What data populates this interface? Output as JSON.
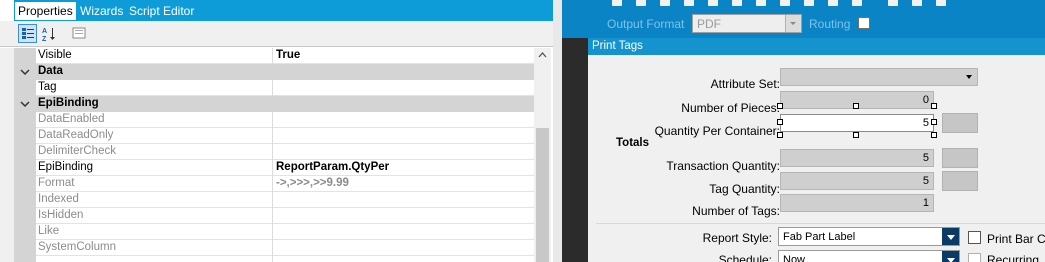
{
  "properties_panel": {
    "tabs": [
      {
        "label": "Properties"
      },
      {
        "label": "Wizards"
      },
      {
        "label": "Script Editor"
      }
    ],
    "toolbar_icons": [
      "categorized-icon",
      "alphabetical-sort-icon",
      "property-pages-icon"
    ],
    "rows": [
      {
        "name": "Visible",
        "value": "True",
        "type": "prop",
        "value_style": "bold"
      },
      {
        "name": "Data",
        "value": "",
        "type": "category"
      },
      {
        "name": "Tag",
        "value": "",
        "type": "prop"
      },
      {
        "name": "EpiBinding",
        "value": "",
        "type": "category"
      },
      {
        "name": "DataEnabled",
        "value": "",
        "type": "prop",
        "name_style": "dim"
      },
      {
        "name": "DataReadOnly",
        "value": "",
        "type": "prop",
        "name_style": "dim"
      },
      {
        "name": "DelimiterCheck",
        "value": "",
        "type": "prop",
        "name_style": "dim"
      },
      {
        "name": "EpiBinding",
        "value": "ReportParam.QtyPer",
        "type": "prop",
        "value_style": "bold"
      },
      {
        "name": "Format",
        "value": "->,>>>,>>9.99",
        "type": "prop",
        "name_style": "dim",
        "value_style": "bold-dim"
      },
      {
        "name": "Indexed",
        "value": "",
        "type": "prop",
        "name_style": "dim"
      },
      {
        "name": "IsHidden",
        "value": "",
        "type": "prop",
        "name_style": "dim"
      },
      {
        "name": "Like",
        "value": "",
        "type": "prop",
        "name_style": "dim"
      },
      {
        "name": "SystemColumn",
        "value": "",
        "type": "prop",
        "name_style": "dim"
      }
    ]
  },
  "designer": {
    "output_format_label": "Output Format",
    "output_format_value": "PDF",
    "routing_label": "Routing",
    "panel_title": "Print Tags",
    "attribute_set_label": "Attribute Set:",
    "attribute_set_value": "",
    "number_of_pieces_label": "Number of Pieces:",
    "number_of_pieces_value": "0",
    "qty_per_container_label": "Quantity Per Container:",
    "qty_per_container_value": "5",
    "totals_label": "Totals",
    "transaction_qty_label": "Transaction Quantity:",
    "transaction_qty_value": "5",
    "tag_qty_label": "Tag Quantity:",
    "tag_qty_value": "5",
    "number_of_tags_label": "Number of Tags:",
    "number_of_tags_value": "1",
    "report_style_label": "Report Style:",
    "report_style_value": "Fab Part Label",
    "print_barcode_label": "Print Bar C",
    "schedule_label": "Schedule:",
    "schedule_value": "Now",
    "recurring_label": "Recurring"
  }
}
